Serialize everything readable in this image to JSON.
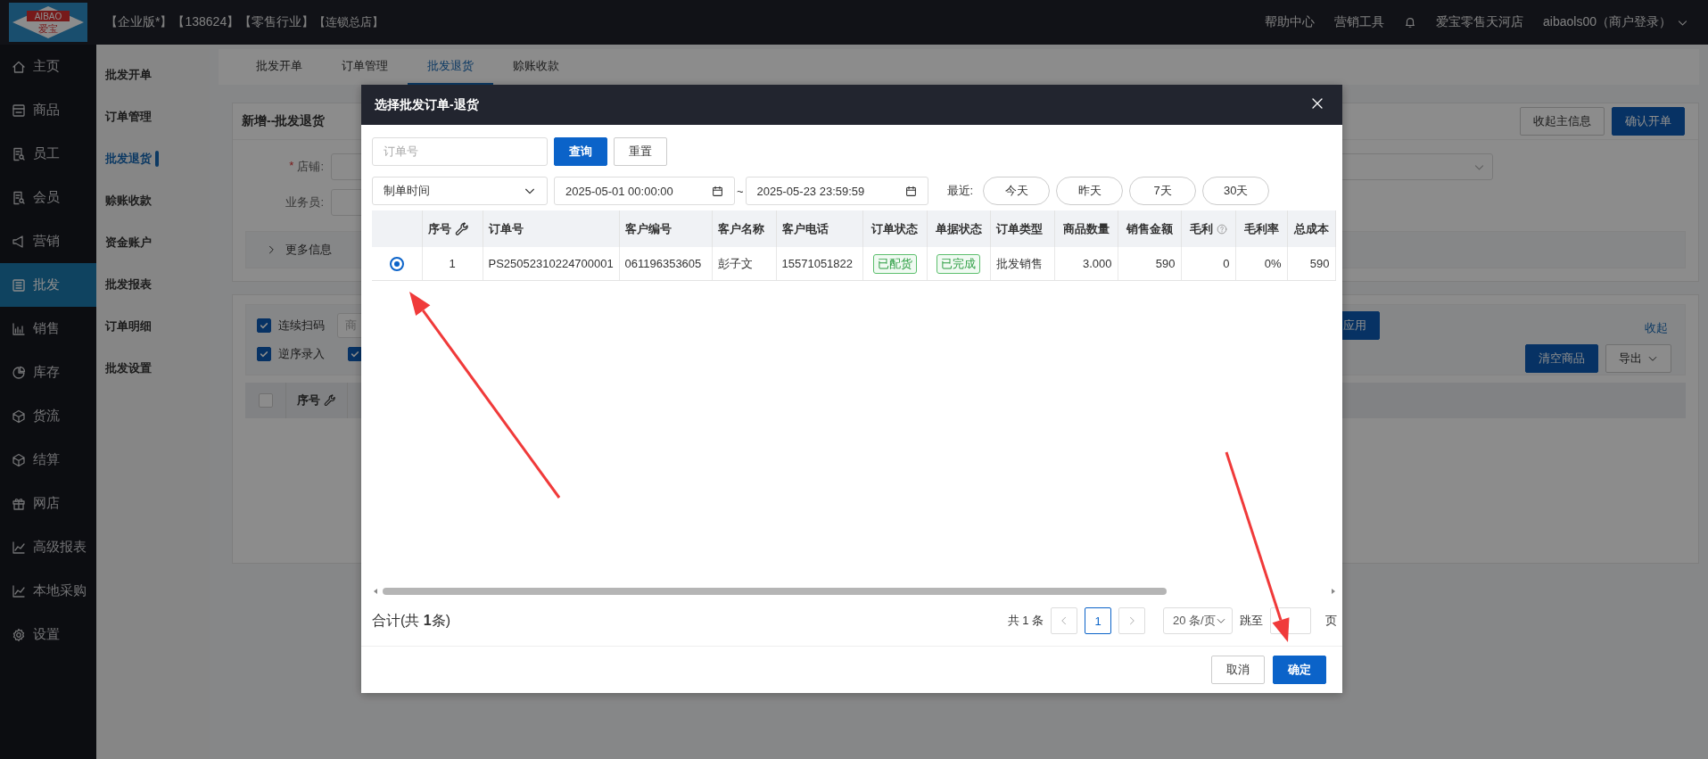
{
  "header": {
    "logo": {
      "top": "AIBAO",
      "bottom": "爱宝"
    },
    "tags": [
      "【企业版*】",
      "【138624】",
      "【零售行业】",
      "【连锁总店】"
    ],
    "links": [
      "帮助中心",
      "营销工具"
    ],
    "store": "爱宝零售天河店",
    "user": "aibaols00（商户登录）"
  },
  "sidebar": {
    "items": [
      {
        "label": "主页",
        "selected": false
      },
      {
        "label": "商品",
        "selected": false
      },
      {
        "label": "员工",
        "selected": false
      },
      {
        "label": "会员",
        "selected": false
      },
      {
        "label": "营销",
        "selected": false
      },
      {
        "label": "批发",
        "selected": true
      },
      {
        "label": "销售",
        "selected": false
      },
      {
        "label": "库存",
        "selected": false
      },
      {
        "label": "货流",
        "selected": false
      },
      {
        "label": "结算",
        "selected": false
      },
      {
        "label": "网店",
        "selected": false
      },
      {
        "label": "高级报表",
        "selected": false
      },
      {
        "label": "本地采购",
        "selected": false
      },
      {
        "label": "设置",
        "selected": false
      }
    ]
  },
  "subnav": {
    "items": [
      {
        "label": "批发开单",
        "selected": false
      },
      {
        "label": "订单管理",
        "selected": false
      },
      {
        "label": "批发退货",
        "selected": true
      },
      {
        "label": "赊账收款",
        "selected": false
      },
      {
        "label": "资金账户",
        "selected": false
      },
      {
        "label": "批发报表",
        "selected": false
      },
      {
        "label": "订单明细",
        "selected": false
      },
      {
        "label": "批发设置",
        "selected": false
      }
    ]
  },
  "tabs": [
    {
      "label": "批发开单",
      "selected": false
    },
    {
      "label": "订单管理",
      "selected": false
    },
    {
      "label": "批发退货",
      "selected": true
    },
    {
      "label": "赊账收款",
      "selected": false
    }
  ],
  "form": {
    "title": "新增--批发退货",
    "buttons": [
      "收起主信息",
      "确认开单"
    ],
    "fields": [
      {
        "label": "店铺:",
        "marker": "*"
      },
      {
        "label": "业务员:"
      }
    ],
    "more": "更多信息"
  },
  "scan": {
    "options": [
      {
        "label": "连续扫码",
        "checked": true
      },
      {
        "label": "逆序录入",
        "checked": true
      },
      {
        "checked": true
      }
    ],
    "placeholder": "商",
    "apply": "应用",
    "collapse": "收起",
    "clear": "清空商品",
    "export": "导出"
  },
  "goods_table": {
    "select_all_checked": false,
    "columns": [
      "序号"
    ]
  },
  "modal": {
    "title": "选择批发订单-退货",
    "order_placeholder": "订单号",
    "query": "查询",
    "reset": "重置",
    "date_type": "制单时间",
    "start": "2025-05-01 00:00:00",
    "separator": "~",
    "end": "2025-05-23 23:59:59",
    "recent_label": "最近:",
    "quick": [
      "今天",
      "昨天",
      "7天",
      "30天"
    ],
    "columns": [
      {
        "label": "序号",
        "kind": "index",
        "tool": true
      },
      {
        "label": "订单号",
        "kind": "text"
      },
      {
        "label": "客户编号",
        "kind": "text"
      },
      {
        "label": "客户名称",
        "kind": "text"
      },
      {
        "label": "客户电话",
        "kind": "text"
      },
      {
        "label": "订单状态",
        "kind": "tag"
      },
      {
        "label": "单据状态",
        "kind": "tag"
      },
      {
        "label": "订单类型",
        "kind": "text"
      },
      {
        "label": "商品数量",
        "kind": "number"
      },
      {
        "label": "销售金额",
        "kind": "number"
      },
      {
        "label": "毛利",
        "kind": "number",
        "help": true
      },
      {
        "label": "毛利率",
        "kind": "number"
      },
      {
        "label": "总成本",
        "kind": "number"
      }
    ],
    "rows": [
      {
        "selected": true,
        "cells": [
          "1",
          "PS25052310224700001",
          "061196353605",
          "彭子文",
          "15571051822",
          "已配货",
          "已完成",
          "批发销售",
          "3.000",
          "590",
          "0",
          "0%",
          "590"
        ]
      }
    ],
    "summary": "合计(共 **1**条)",
    "total": "共 1 条",
    "page": "1",
    "page_size": "20 条/页",
    "jump": "跳至",
    "page_unit": "页",
    "cancel": "取消",
    "confirm": "确定"
  }
}
